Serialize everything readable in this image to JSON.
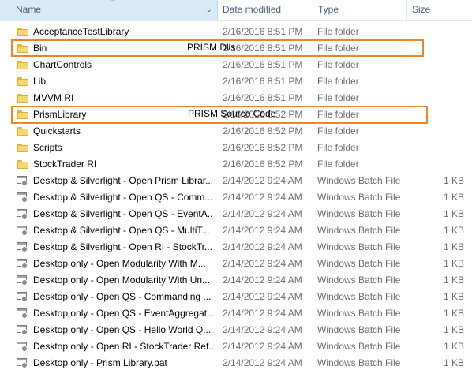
{
  "columns": {
    "name": "Name",
    "date": "Date modified",
    "type": "Type",
    "size": "Size"
  },
  "rows": [
    {
      "name": "AcceptanceTestLibrary",
      "date": "2/16/2016 8:51 PM",
      "type": "File folder",
      "size": "",
      "icon": "folder-icon"
    },
    {
      "name": "Bin",
      "date": "2/16/2016 8:51 PM",
      "type": "File folder",
      "size": "",
      "icon": "folder-icon"
    },
    {
      "name": "ChartControls",
      "date": "2/16/2016 8:51 PM",
      "type": "File folder",
      "size": "",
      "icon": "folder-icon"
    },
    {
      "name": "Lib",
      "date": "2/16/2016 8:51 PM",
      "type": "File folder",
      "size": "",
      "icon": "folder-icon"
    },
    {
      "name": "MVVM RI",
      "date": "2/16/2016 8:51 PM",
      "type": "File folder",
      "size": "",
      "icon": "folder-icon"
    },
    {
      "name": "PrismLibrary",
      "date": "2/16/2016 8:52 PM",
      "type": "File folder",
      "size": "",
      "icon": "folder-icon"
    },
    {
      "name": "Quickstarts",
      "date": "2/16/2016 8:52 PM",
      "type": "File folder",
      "size": "",
      "icon": "folder-icon"
    },
    {
      "name": "Scripts",
      "date": "2/16/2016 8:52 PM",
      "type": "File folder",
      "size": "",
      "icon": "folder-icon"
    },
    {
      "name": "StockTrader RI",
      "date": "2/16/2016 8:52 PM",
      "type": "File folder",
      "size": "",
      "icon": "folder-icon"
    },
    {
      "name": "Desktop & Silverlight - Open Prism Librar...",
      "date": "2/14/2012 9:24 AM",
      "type": "Windows Batch File",
      "size": "1 KB",
      "icon": "batch-file-icon"
    },
    {
      "name": "Desktop & Silverlight - Open QS - Comm...",
      "date": "2/14/2012 9:24 AM",
      "type": "Windows Batch File",
      "size": "1 KB",
      "icon": "batch-file-icon"
    },
    {
      "name": "Desktop & Silverlight - Open QS - EventA...",
      "date": "2/14/2012 9:24 AM",
      "type": "Windows Batch File",
      "size": "1 KB",
      "icon": "batch-file-icon"
    },
    {
      "name": "Desktop & Silverlight - Open QS - MultiT...",
      "date": "2/14/2012 9:24 AM",
      "type": "Windows Batch File",
      "size": "1 KB",
      "icon": "batch-file-icon"
    },
    {
      "name": "Desktop & Silverlight - Open RI - StockTr...",
      "date": "2/14/2012 9:24 AM",
      "type": "Windows Batch File",
      "size": "1 KB",
      "icon": "batch-file-icon"
    },
    {
      "name": "Desktop only - Open Modularity With M...",
      "date": "2/14/2012 9:24 AM",
      "type": "Windows Batch File",
      "size": "1 KB",
      "icon": "batch-file-icon"
    },
    {
      "name": "Desktop only - Open Modularity With Un...",
      "date": "2/14/2012 9:24 AM",
      "type": "Windows Batch File",
      "size": "1 KB",
      "icon": "batch-file-icon"
    },
    {
      "name": "Desktop only - Open QS - Commanding ...",
      "date": "2/14/2012 9:24 AM",
      "type": "Windows Batch File",
      "size": "1 KB",
      "icon": "batch-file-icon"
    },
    {
      "name": "Desktop only - Open QS - EventAggregat...",
      "date": "2/14/2012 9:24 AM",
      "type": "Windows Batch File",
      "size": "1 KB",
      "icon": "batch-file-icon"
    },
    {
      "name": "Desktop only - Open QS - Hello World Q...",
      "date": "2/14/2012 9:24 AM",
      "type": "Windows Batch File",
      "size": "1 KB",
      "icon": "batch-file-icon"
    },
    {
      "name": "Desktop only - Open RI - StockTrader Ref...",
      "date": "2/14/2012 9:24 AM",
      "type": "Windows Batch File",
      "size": "1 KB",
      "icon": "batch-file-icon"
    },
    {
      "name": "Desktop only - Prism Library.bat",
      "date": "2/14/2012 9:24 AM",
      "type": "Windows Batch File",
      "size": "1 KB",
      "icon": "batch-file-icon"
    }
  ],
  "annotations": {
    "bin_callout": "PRISM Dlls",
    "prism_library_callout": "PRISM Source Code",
    "highlight_color": "#e8862a"
  }
}
